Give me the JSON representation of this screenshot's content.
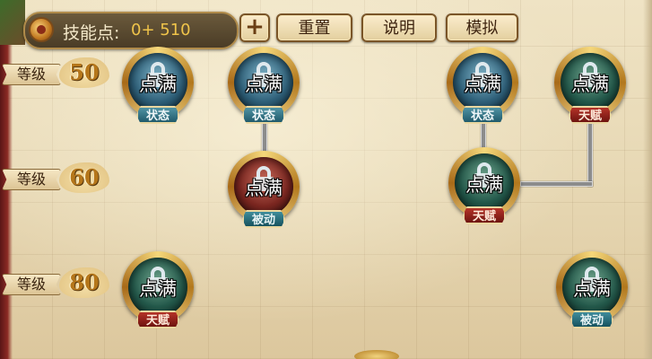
{
  "header": {
    "skill_points_label": "技能点:",
    "skill_points_value": "0+ 510",
    "add_button": "+",
    "reset_button": "重置",
    "help_button": "说明",
    "simulate_button": "模拟"
  },
  "levels": [
    {
      "label": "等级",
      "value": "50"
    },
    {
      "label": "等级",
      "value": "60"
    },
    {
      "label": "等级",
      "value": "80"
    }
  ],
  "skills": [
    {
      "status": "点满",
      "tag": "状态",
      "kind": "state",
      "color": "blue"
    },
    {
      "status": "点满",
      "tag": "状态",
      "kind": "state",
      "color": "blue"
    },
    {
      "status": "点满",
      "tag": "状态",
      "kind": "state",
      "color": "blue"
    },
    {
      "status": "点满",
      "tag": "天赋",
      "kind": "talent",
      "color": "green"
    },
    {
      "status": "点满",
      "tag": "被动",
      "kind": "passive",
      "color": "red"
    },
    {
      "status": "点满",
      "tag": "天赋",
      "kind": "talent",
      "color": "green"
    },
    {
      "status": "点满",
      "tag": "天赋",
      "kind": "talent",
      "color": "green"
    },
    {
      "status": "点满",
      "tag": "被动",
      "kind": "passive",
      "color": "green"
    }
  ]
}
